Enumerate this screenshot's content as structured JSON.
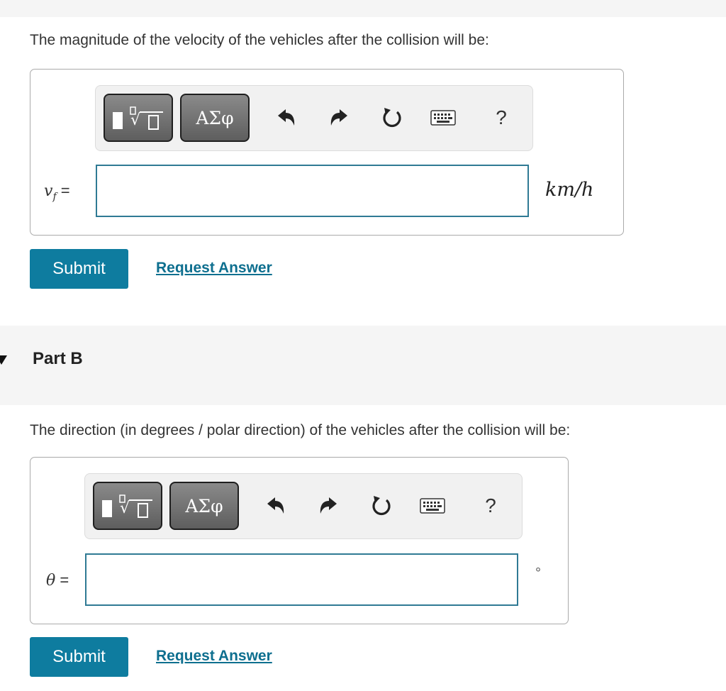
{
  "part_a": {
    "prompt": "The magnitude of the velocity of the vehicles after the collision will be:",
    "variable_main": "v",
    "variable_sub": "f",
    "equals": "=",
    "unit": "km/h",
    "input_value": "",
    "submit_label": "Submit",
    "request_label": "Request Answer"
  },
  "part_b": {
    "header": "Part B",
    "prompt": "The direction (in degrees / polar direction) of the vehicles after the collision will be:",
    "variable": "θ",
    "equals": "=",
    "unit": "°",
    "input_value": "",
    "submit_label": "Submit",
    "request_label": "Request Answer"
  },
  "toolbar": {
    "greek_label": "ΑΣφ",
    "help_label": "?",
    "icons": [
      "templates-icon",
      "greek-symbols-icon",
      "undo-icon",
      "redo-icon",
      "reset-icon",
      "keyboard-icon",
      "help-icon"
    ]
  },
  "colors": {
    "accent": "#0e7c9f",
    "link": "#0e6f8f",
    "input_border": "#2f7a94",
    "band": "#f5f5f5"
  }
}
